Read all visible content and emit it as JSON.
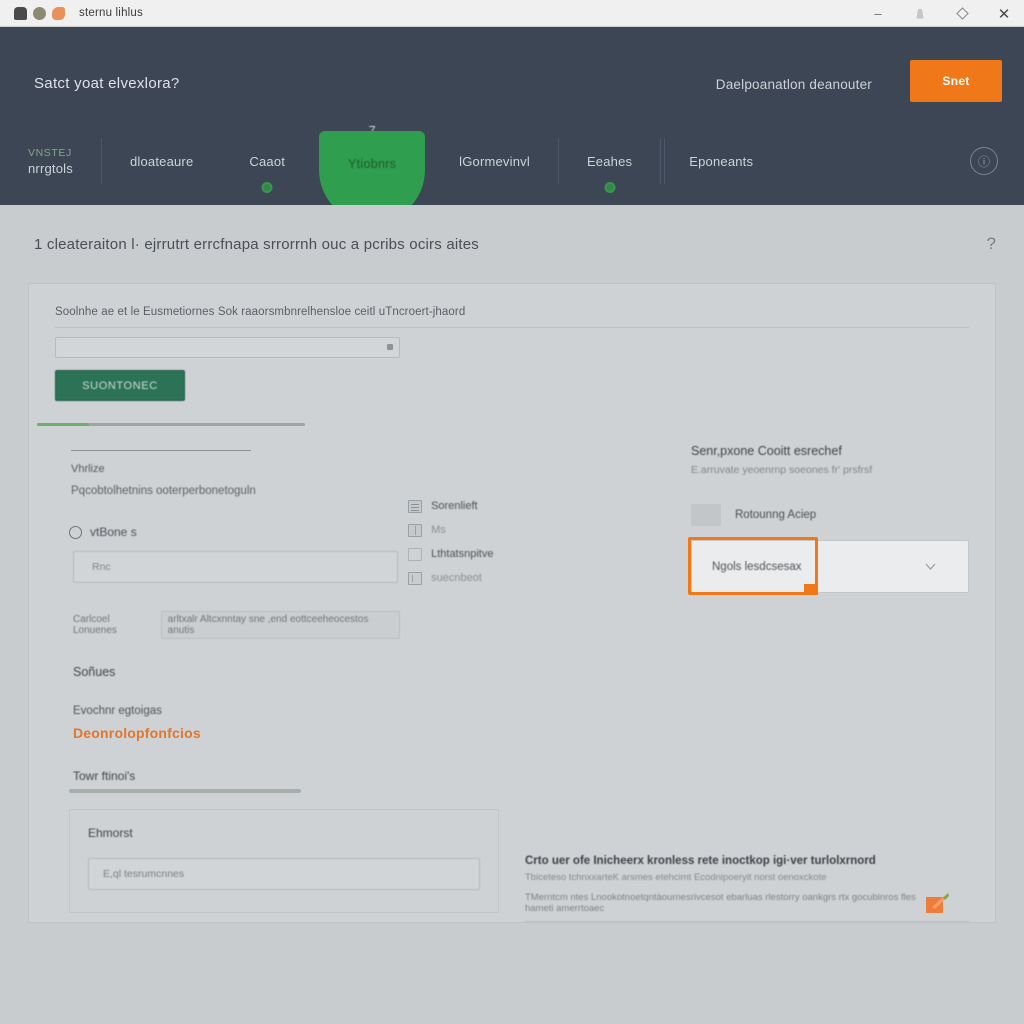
{
  "window": {
    "title": "sternu lihlus",
    "icons": [
      "app-icon",
      "status-dot-icon",
      "profile-icon"
    ],
    "controls": {
      "minimize": "minimize-icon",
      "restore": "restore-icon",
      "close": "✕"
    }
  },
  "header": {
    "title": "Satct yoat elvexlora?",
    "note": "Daelpoanatlon deanouter",
    "cta_label": "Snet",
    "accent_orange": "#f07818",
    "background": "#3c4654",
    "nav": {
      "items": [
        {
          "eyebrow": "VNSTEJ",
          "label": "nrrgtols",
          "dot": false
        },
        {
          "eyebrow": "",
          "label": "dloateaure",
          "dot": false
        },
        {
          "eyebrow": "",
          "label": "Caaot",
          "dot": true
        },
        {
          "eyebrow": "",
          "label": "lGormevinvl",
          "dot": false
        },
        {
          "eyebrow": "",
          "label": "Eeahes",
          "dot": true
        },
        {
          "eyebrow": "",
          "label": "Eponeants",
          "dot": false
        }
      ],
      "active": {
        "label": "Ytiobnrs",
        "badge": "7",
        "color": "#2f9e4f"
      },
      "info_icon": "info-icon"
    }
  },
  "page": {
    "title": "1 cleateraiton l· ejrrutrt errcfnapa srrorrnh ouc a  pcribs ocirs aites",
    "help_icon": "?"
  },
  "select_block": {
    "label": "Soolnhe ae et le  Eusmetiornes Sok raaorsmbnrelhensloe ceitl uTncroert-jhaord",
    "value": "",
    "caret_icon": "caret-down-icon",
    "button_label": "SUONTONEC"
  },
  "progress": {
    "percent": 19
  },
  "left_column": {
    "mini_label": "Vhrlize",
    "mini_sub": "Pqcobtolhetnins ooterperbonetoguln",
    "radio_label": "vtBone s",
    "radio_checked": false,
    "text_input_value": "Rnc",
    "hint_prefix": "Carlcoel Lonuenes",
    "hint_box": "arltxalr Altcxnntay sne ,end eottceeheocestos anutis",
    "section_heading": "Soñues",
    "section_sub": "Evochnr egtoigas",
    "link_label": "Deonrolopfonfcios",
    "section_heading2": "Towr ftinoi's"
  },
  "mid_column": {
    "items": [
      {
        "icon": "list-icon",
        "label": "Sorenlieft",
        "faint": false
      },
      {
        "icon": "book-icon",
        "label": "Ms",
        "faint": true
      },
      {
        "icon": "checkbox-icon",
        "label": "Lthtatsnpitve",
        "faint": false
      },
      {
        "icon": "panel-icon",
        "label": "suecnbeot",
        "faint": true
      }
    ]
  },
  "right_column": {
    "title": "Senr,pxone Cooitt esrechef",
    "subtitle": "E.arruvate yeoenrnp soeones fr' prsfrsf",
    "swatch_label": "Rotounng Aciep",
    "select_value": "Ngols lesdcsesax",
    "chevron_icon": "chevron-down-icon",
    "highlight_color": "#f07818"
  },
  "notes": {
    "title": "Ehmorst",
    "input_value": "E,ql tesrumcnnes"
  },
  "footer": {
    "title": "Crto uer ofe Inicheerx kronless rete inoctkop igi·ver turlolxrnord",
    "line1": "Tbiceteso tchnxxarteK arsmes etehcimt  Ecodnipoeryit norst oenoxckote",
    "line2": "TMerntcm ntes Lnookotnoetqntàournesrivcesot ebarluas rlestorry oankgrs rtx gocubinros fles hameti amerrtoaec",
    "edit_icon": "edit-pencil-icon"
  }
}
